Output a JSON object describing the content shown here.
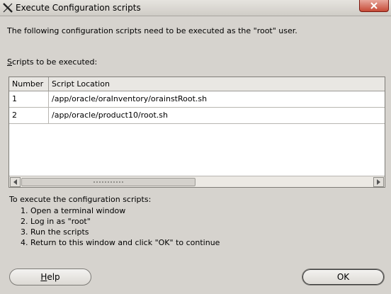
{
  "window": {
    "title": "Execute Configuration scripts"
  },
  "intro": "The following configuration scripts need to be executed as the \"root\" user.",
  "scripts_label": {
    "mnemonic": "S",
    "rest": "cripts to be executed:"
  },
  "table": {
    "columns": [
      "Number",
      "Script Location"
    ],
    "rows": [
      {
        "number": "1",
        "location": "/app/oracle/oraInventory/orainstRoot.sh"
      },
      {
        "number": "2",
        "location": "/app/oracle/product10/root.sh"
      }
    ]
  },
  "instructions": {
    "title": "To execute the configuration scripts:",
    "steps": [
      "1. Open a terminal window",
      "2. Log in as \"root\"",
      "3. Run the scripts",
      "4. Return to this window and click \"OK\" to continue"
    ]
  },
  "buttons": {
    "help_mnemonic": "H",
    "help_rest": "elp",
    "ok": "OK"
  },
  "icons": {
    "app": "x-window-icon",
    "close": "close-icon",
    "scroll_left": "arrow-left-icon",
    "scroll_right": "arrow-right-icon"
  },
  "colors": {
    "close_button": "#c64a36",
    "background": "#d6d3ce"
  }
}
